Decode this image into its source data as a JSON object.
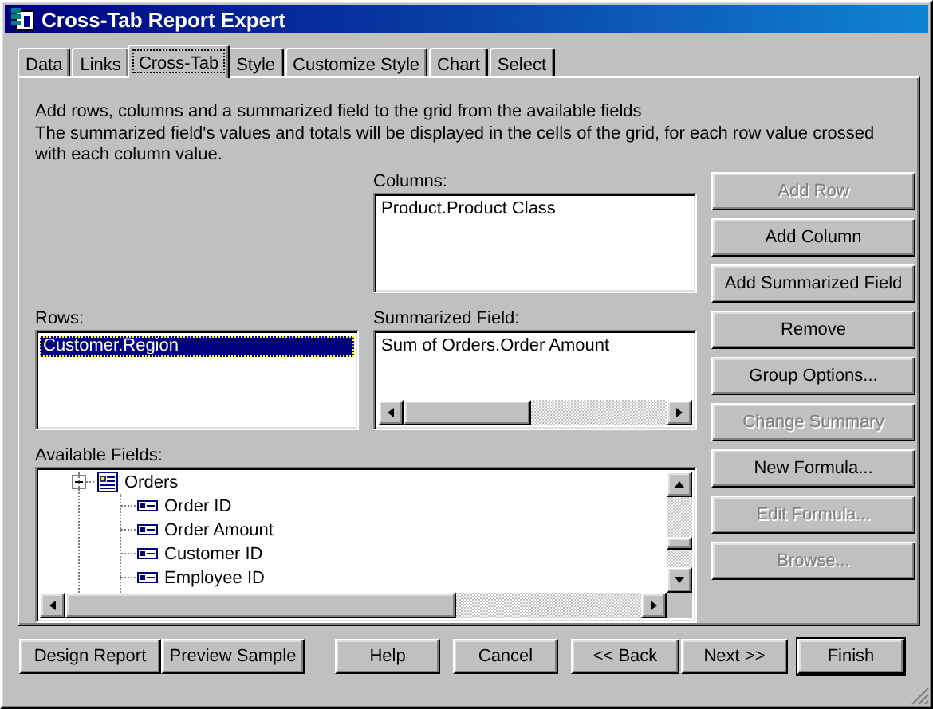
{
  "window": {
    "title": "Cross-Tab Report Expert"
  },
  "tabs": [
    {
      "label": "Data",
      "selected": false
    },
    {
      "label": "Links",
      "selected": false
    },
    {
      "label": "Cross-Tab",
      "selected": true
    },
    {
      "label": "Style",
      "selected": false
    },
    {
      "label": "Customize Style",
      "selected": false
    },
    {
      "label": "Chart",
      "selected": false
    },
    {
      "label": "Select",
      "selected": false
    }
  ],
  "description": [
    "Add rows, columns and a summarized field to the grid from the available fields",
    "The summarized field's values and totals will be displayed in the cells of the grid, for each row value crossed with each column value."
  ],
  "columns": {
    "label": "Columns:",
    "items": [
      {
        "text": "Product.Product Class",
        "selected": false
      }
    ]
  },
  "rows": {
    "label": "Rows:",
    "items": [
      {
        "text": "Customer.Region",
        "selected": true
      }
    ]
  },
  "summarized_field": {
    "label": "Summarized Field:",
    "items": [
      {
        "text": "Sum of Orders.Order Amount",
        "selected": false
      }
    ]
  },
  "available_fields": {
    "label": "Available Fields:",
    "tree": [
      {
        "text": "Orders",
        "expanded": true,
        "children": [
          {
            "text": "Order ID"
          },
          {
            "text": "Order Amount"
          },
          {
            "text": "Customer ID"
          },
          {
            "text": "Employee ID"
          }
        ]
      }
    ]
  },
  "side_buttons": [
    {
      "label": "Add Row",
      "disabled": true
    },
    {
      "label": "Add Column",
      "disabled": false
    },
    {
      "label": "Add Summarized Field",
      "disabled": false
    },
    {
      "label": "Remove",
      "disabled": false
    },
    {
      "label": "Group Options...",
      "disabled": false
    },
    {
      "label": "Change Summary",
      "disabled": true
    },
    {
      "label": "New Formula...",
      "disabled": false
    },
    {
      "label": "Edit Formula...",
      "disabled": true
    },
    {
      "label": "Browse...",
      "disabled": true
    }
  ],
  "footer_buttons": [
    {
      "label": "Design Report",
      "default": false
    },
    {
      "label": "Preview Sample",
      "default": false
    },
    {
      "label": "Help",
      "default": false
    },
    {
      "label": "Cancel",
      "default": false
    },
    {
      "label": "<< Back",
      "default": false
    },
    {
      "label": "Next >>",
      "default": false
    },
    {
      "label": "Finish",
      "default": true
    }
  ]
}
